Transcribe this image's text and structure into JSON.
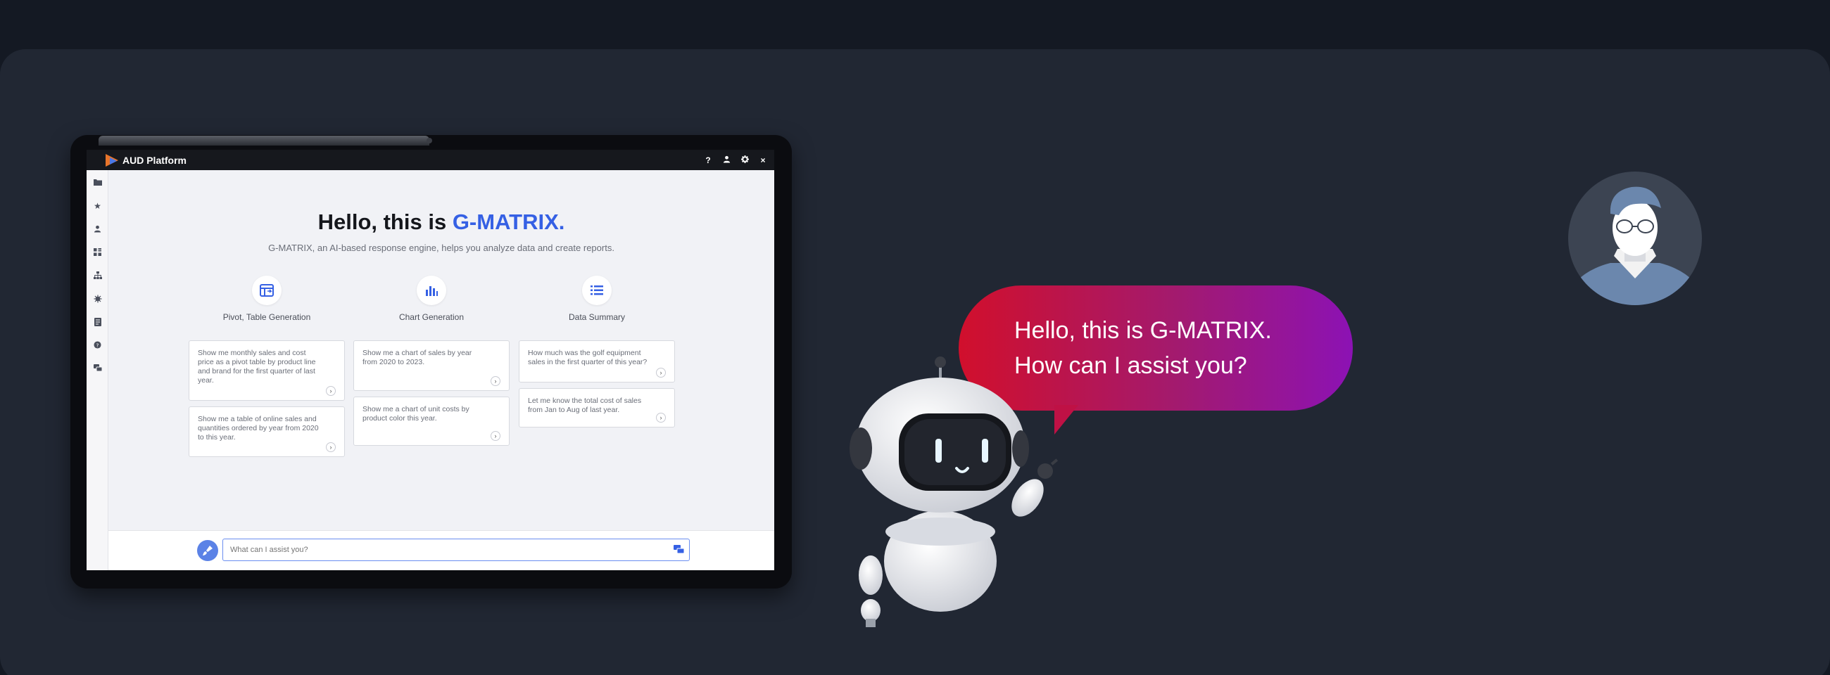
{
  "app": {
    "title": "AUD Platform"
  },
  "titlebar": {
    "icons": [
      "help-icon",
      "user-icon",
      "gear-icon",
      "close-icon"
    ],
    "help": "?",
    "close": "×"
  },
  "sidebar": {
    "icons": [
      "folder-icon",
      "star-icon",
      "user-icon",
      "grid-icon",
      "org-chart-icon",
      "bug-icon",
      "report-icon",
      "shield-icon",
      "chat-icon"
    ]
  },
  "hero": {
    "greeting": "Hello, this is ",
    "brand": "G-MATRIX.",
    "subtitle": "G-MATRIX, an AI-based response engine, helps you analyze data and create reports."
  },
  "categories": [
    {
      "label": "Pivot, Table Generation",
      "icon": "pivot-table-icon",
      "cards": [
        "Show me monthly sales and cost price as a pivot table by product line and brand for the first quarter of last year.",
        "Show me a table of online sales and quantities ordered by year from 2020 to this year."
      ]
    },
    {
      "label": "Chart Generation",
      "icon": "bar-chart-icon",
      "cards": [
        "Show me a chart of sales by year from 2020 to 2023.",
        "Show me a chart of unit costs by product color this year."
      ]
    },
    {
      "label": "Data Summary",
      "icon": "list-icon",
      "cards": [
        "How much was the golf equipment sales in the first quarter of this year?",
        "Let me know the total cost of sales from Jan to Aug of last year."
      ]
    }
  ],
  "prompt": {
    "placeholder": "What can I assist you?"
  },
  "bubble": {
    "line1": "Hello, this is G-MATRIX.",
    "line2": "How can I assist you?"
  },
  "colors": {
    "accent": "#3560e4",
    "bubble_start": "#d10f2c",
    "bubble_end": "#8c12b4"
  }
}
